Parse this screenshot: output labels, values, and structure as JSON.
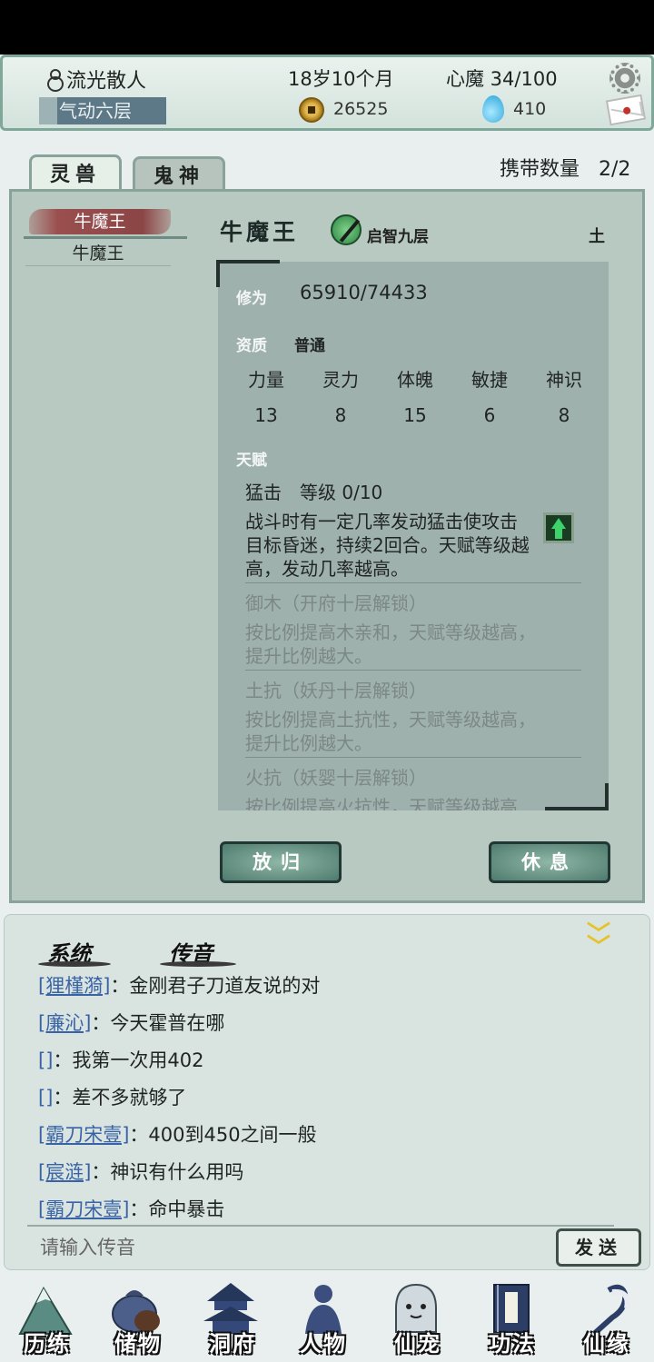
{
  "header": {
    "player_name": "流光散人",
    "realm": "气动六层",
    "age": "18岁10个月",
    "xinmo": "心魔 34/100",
    "money": "26525",
    "gems": "410"
  },
  "tabs": {
    "spirit_beast": "灵兽",
    "ghost_god": "鬼神"
  },
  "carry": {
    "label": "携带数量",
    "value": "2/2"
  },
  "beast_list": [
    "牛魔王",
    "牛魔王"
  ],
  "pet": {
    "name": "牛魔王",
    "stage": "启智九层",
    "element": "土",
    "xiuwei_label": "修为",
    "xiuwei_value": "65910/74433",
    "zizhi_label": "资质",
    "zizhi_value": "普通",
    "stats": [
      {
        "name": "力量",
        "value": "13"
      },
      {
        "name": "灵力",
        "value": "8"
      },
      {
        "name": "体魄",
        "value": "15"
      },
      {
        "name": "敏捷",
        "value": "6"
      },
      {
        "name": "神识",
        "value": "8"
      }
    ],
    "talent_label": "天赋",
    "talents": [
      {
        "title": "猛击　等级  0/10",
        "desc": "战斗时有一定几率发动猛击使攻击目标昏迷，持续2回合。天赋等级越高，发动几率越高。"
      },
      {
        "title": "御木（开府十层解锁）",
        "desc": "按比例提高木亲和，天赋等级越高，提升比例越大。"
      },
      {
        "title": "土抗（妖丹十层解锁）",
        "desc": "按比例提高土抗性，天赋等级越高，提升比例越大。"
      },
      {
        "title": "火抗（妖婴十层解锁）",
        "desc": "按比例提高火抗性，天赋等级越高"
      }
    ]
  },
  "buttons": {
    "release": "放归",
    "rest": "休息"
  },
  "chat": {
    "tab_system": "系统",
    "tab_voice": "传音",
    "messages": [
      {
        "user": "[狸槿漪]",
        "text": "：金刚君子刀道友说的对"
      },
      {
        "user": "[廉沁]",
        "text": "：今天霍普在哪"
      },
      {
        "user": "[]",
        "text": "：我第一次用402"
      },
      {
        "user": "[]",
        "text": "：差不多就够了"
      },
      {
        "user": "[霸刀宋壹]",
        "text": "：400到450之间一般"
      },
      {
        "user": "[宸涟]",
        "text": "：神识有什么用吗"
      },
      {
        "user": "[霸刀宋壹]",
        "text": "：命中暴击"
      }
    ],
    "input_placeholder": "请输入传音",
    "send": "发送"
  },
  "nav": [
    {
      "label": "历练",
      "icon": "mountain-icon"
    },
    {
      "label": "储物",
      "icon": "bag-icon"
    },
    {
      "label": "洞府",
      "icon": "pavilion-icon"
    },
    {
      "label": "人物",
      "icon": "person-icon"
    },
    {
      "label": "仙宠",
      "icon": "ghost-pet-icon"
    },
    {
      "label": "功法",
      "icon": "book-icon"
    },
    {
      "label": "仙缘",
      "icon": "crane-icon"
    }
  ]
}
